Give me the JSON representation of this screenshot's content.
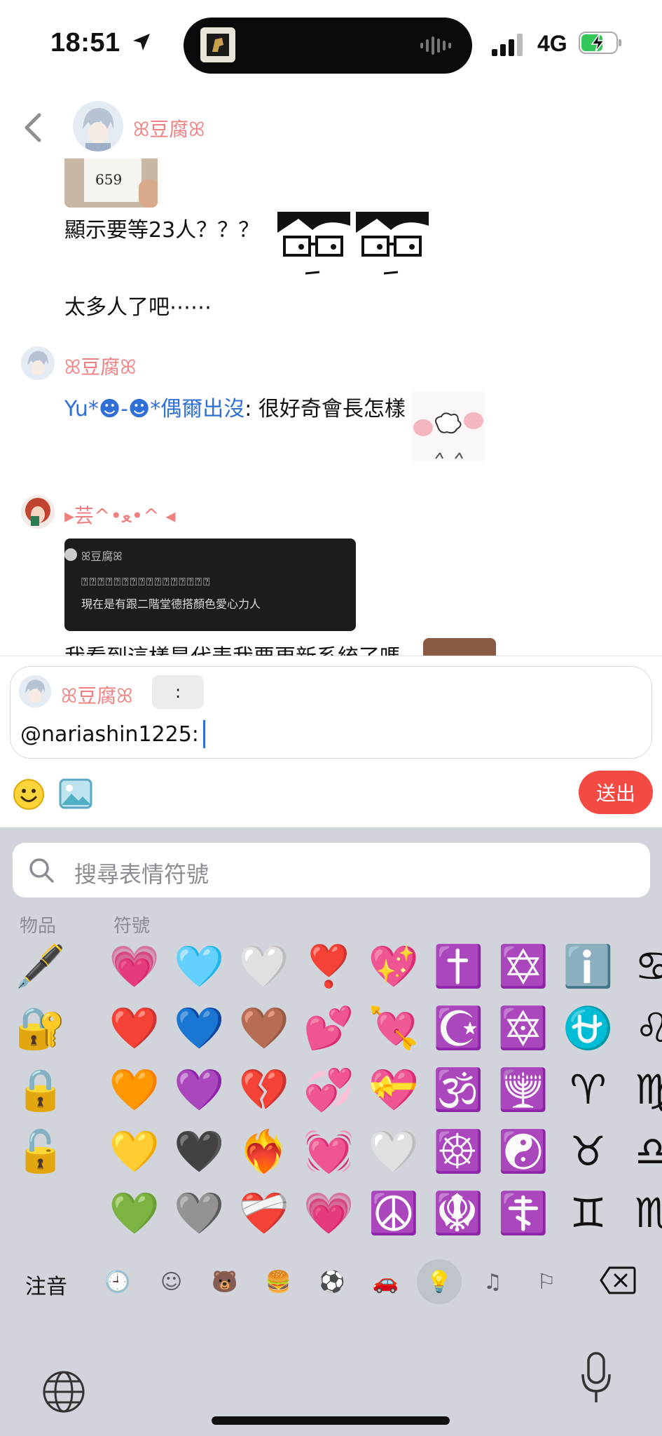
{
  "status_bar": {
    "time": "18:51",
    "network": "4G"
  },
  "header": {
    "username": "ꕤ豆腐ꕤ"
  },
  "messages": [
    {
      "ticket_number": "659",
      "text_line1": "顯示要等23人？？？",
      "text_line2": "太多人了吧⋯⋯"
    },
    {
      "username": "ꕤ豆腐ꕤ",
      "mention": "Yu*☻-☻*偶爾出沒",
      "text": ": 很好奇會長怎樣"
    },
    {
      "username": "▸芸^•ﻌ•^ ◂",
      "quote_user": "ꕤ豆腐ꕤ",
      "quote_line1": "⍰⍰⍰⍰⍰⍰⍰⍰⍰⍰⍰⍰⍰⍰⍰⍰",
      "quote_line2": "現在是有跟二階堂德搭顏色愛心力人",
      "text": "我看到這樣是代表我要更新系統了嗎"
    }
  ],
  "reply": {
    "username": "ꕤ豆腐ꕤ",
    "colon_chip": ":",
    "input_value": "@nariashin1225:",
    "send_label": "送出"
  },
  "keyboard": {
    "search_placeholder": "搜尋表情符號",
    "category_objects": "物品",
    "category_symbols": "符號",
    "objects_column": [
      "🖋️",
      "🔐",
      "🔒",
      "🔓"
    ],
    "symbols_grid": [
      [
        "💗",
        "🩵",
        "🤍",
        "❣️",
        "💖",
        "✝️",
        "✡️",
        "ℹ️",
        "♋"
      ],
      [
        "❤️",
        "💙",
        "🤎",
        "💕",
        "💘",
        "☪️",
        "🔯",
        "⛎",
        "♌"
      ],
      [
        "🧡",
        "💜",
        "💔",
        "💞",
        "💝",
        "🕉️",
        "🕎",
        "♈",
        "♍"
      ],
      [
        "💛",
        "🖤",
        "❤️‍🔥",
        "💓",
        "🤍",
        "☸️",
        "☯️",
        "♉",
        "♎"
      ],
      [
        "💚",
        "🩶",
        "❤️‍🩹",
        "💗",
        "☮️",
        "🪯",
        "☦️",
        "♊",
        "♏"
      ]
    ],
    "lang_label": "注音",
    "tabs": [
      "🕘",
      "☺",
      "🐻",
      "🍔",
      "⚽",
      "🚗",
      "💡",
      "♫",
      "⚐"
    ]
  }
}
